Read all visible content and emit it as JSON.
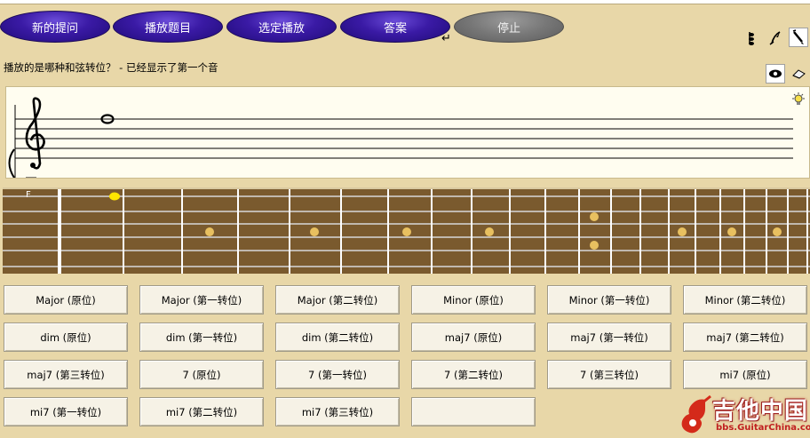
{
  "toolbar": {
    "buttons": [
      {
        "label": "新的提问"
      },
      {
        "label": "播放题目"
      },
      {
        "label": "选定播放"
      },
      {
        "label": "答案"
      },
      {
        "label": "停止"
      }
    ]
  },
  "icons": {
    "return": "return-icon",
    "tools": [
      "note-icon",
      "quill-icon",
      "pen-icon",
      "eye-icon",
      "eraser-icon",
      "lightbulb-icon"
    ]
  },
  "question": "播放的是哪种和弦转位？ - 已经显示了第一个音",
  "fretboard": {
    "string_label": "F"
  },
  "chords": [
    "Major (原位)",
    "Major (第一转位)",
    "Major (第二转位)",
    "Minor (原位)",
    "Minor (第一转位)",
    "Minor (第二转位)",
    "dim (原位)",
    "dim (第一转位)",
    "dim (第二转位)",
    "maj7 (原位)",
    "maj7 (第一转位)",
    "maj7 (第二转位)",
    "maj7 (第三转位)",
    "7 (原位)",
    "7 (第一转位)",
    "7 (第二转位)",
    "7 (第三转位)",
    "mi7 (原位)",
    "mi7 (第一转位)",
    "mi7 (第二转位)",
    "mi7 (第三转位)",
    ""
  ],
  "watermark": {
    "title": "吉他中国",
    "url": "bbs.GuitarChina.com"
  },
  "colors": {
    "background": "#e8d7a8",
    "button_blue": "#3a1aa5",
    "button_grey": "#777777",
    "fretboard": "#7a5a2e",
    "marker": "#e8c060",
    "highlight": "#ffe600"
  }
}
